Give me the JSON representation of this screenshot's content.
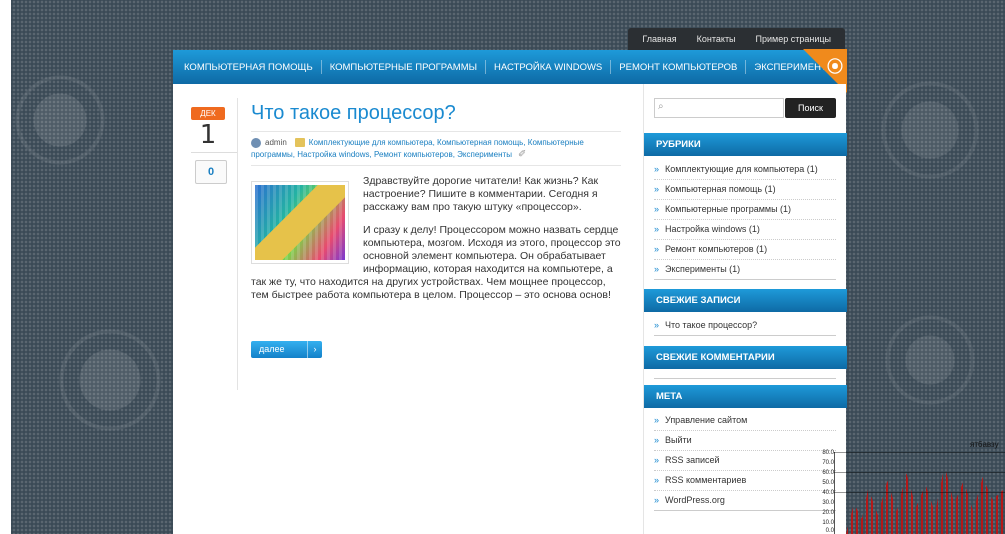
{
  "top_nav": [
    "Главная",
    "Контакты",
    "Пример страницы"
  ],
  "menu": [
    "КОМПЬЮТЕРНАЯ ПОМОЩЬ",
    "КОМПЬЮТЕРНЫЕ ПРОГРАММЫ",
    "НАСТРОЙКА WINDOWS",
    "РЕМОНТ КОМПЬЮТЕРОВ",
    "ЭКСПЕРИМЕНТЫ"
  ],
  "post": {
    "date_month": "ДЕК",
    "date_day": "1",
    "comments": "0",
    "title": "Что такое процессор?",
    "author": "admin",
    "categories": "Комплектующие для компьютера, Компьютерная помощь, Компьютерные программы, Настройка windows, Ремонт компьютеров, Эксперименты",
    "para1": "Здравствуйте дорогие читатели! Как жизнь? Как настроение? Пишите в комментарии. Сегодня я расскажу вам про такую штуку «процессор».",
    "para2": "И сразу к делу! Процессором можно назвать сердце компьютера, мозгом. Исходя из этого, процессор это основной элемент компьютера. Он обрабатывает информацию, которая находится на компьютере, а так же ту, что находится на других устройствах. Чем мощнее процессор, тем быстрее работа компьютера в целом. Процессор – это основа основ!",
    "more": "далее"
  },
  "search": {
    "placeholder": "",
    "button": "Поиск"
  },
  "widgets": {
    "rubrics": {
      "title": "РУБРИКИ",
      "items": [
        "Комплектующие для компьютера (1)",
        "Компьютерная помощь (1)",
        "Компьютерные программы (1)",
        "Настройка windows (1)",
        "Ремонт компьютеров (1)",
        "Эксперименты (1)"
      ]
    },
    "recent_posts": {
      "title": "СВЕЖИЕ ЗАПИСИ",
      "items": [
        "Что такое процессор?"
      ]
    },
    "recent_comments": {
      "title": "СВЕЖИЕ КОММЕНТАРИИ"
    },
    "meta": {
      "title": "МЕТА",
      "items": [
        "Управление сайтом",
        "Выйти",
        "RSS записей",
        "RSS комментариев",
        "WordPress.org"
      ]
    }
  },
  "overlay_graph": {
    "label": "ят6авзу",
    "ticks": [
      "80.0",
      "70.0",
      "60.0",
      "50.0",
      "40.0",
      "30.0",
      "20.0",
      "10.0",
      "0.0"
    ],
    "bar_color": "#b51818"
  },
  "colors": {
    "accent": "#1a8ad0",
    "rss": "#f08a1c",
    "date_month": "#ef6a1f"
  }
}
